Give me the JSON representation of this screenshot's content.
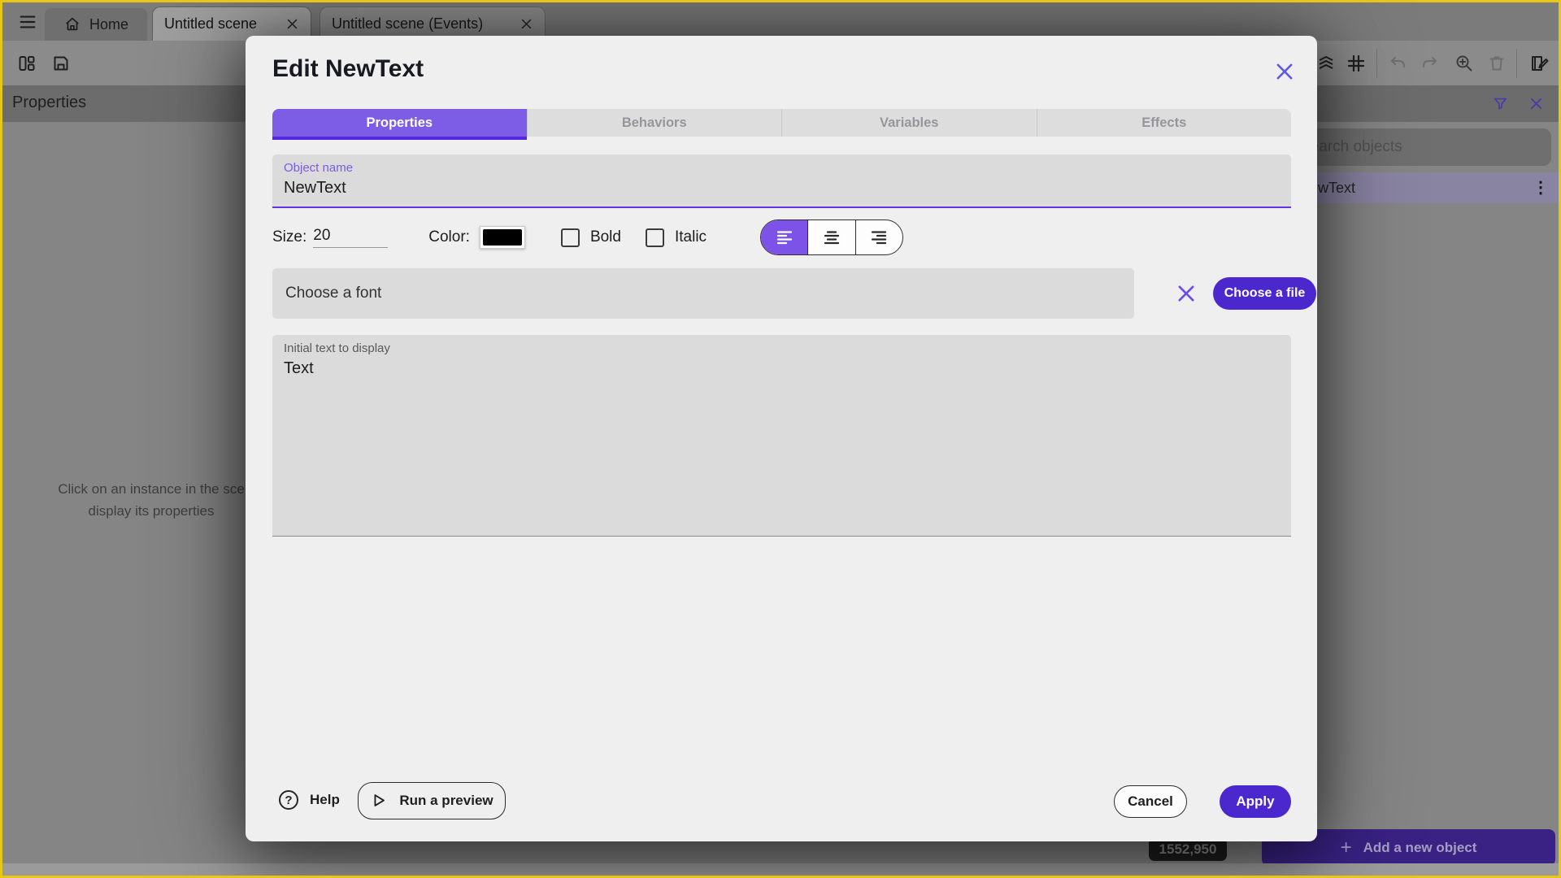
{
  "titlebar": {
    "tabs": [
      {
        "label": "Home",
        "active": false
      },
      {
        "label": "Untitled scene",
        "active": true
      },
      {
        "label": "Untitled scene (Events)",
        "active": false
      }
    ]
  },
  "left_panel": {
    "header": "Properties",
    "empty_message_line1": "Click on an instance in the sce",
    "empty_message_line2": "display its properties"
  },
  "objects_panel": {
    "search_placeholder": "Search objects",
    "items": [
      {
        "name": "NewText",
        "selected": true
      }
    ],
    "add_button_label": "Add a new object"
  },
  "scene": {
    "coordinates": "1552,950"
  },
  "dialog": {
    "title": "Edit NewText",
    "tabs": [
      {
        "label": "Properties",
        "active": true
      },
      {
        "label": "Behaviors",
        "active": false
      },
      {
        "label": "Variables",
        "active": false
      },
      {
        "label": "Effects",
        "active": false
      }
    ],
    "object_name": {
      "label": "Object name",
      "value": "NewText"
    },
    "size": {
      "label": "Size:",
      "value": "20"
    },
    "color": {
      "label": "Color:",
      "value_hex": "#000000"
    },
    "style": {
      "bold_label": "Bold",
      "bold_checked": false,
      "italic_label": "Italic",
      "italic_checked": false
    },
    "alignment": {
      "selected": "left",
      "options": [
        "left",
        "center",
        "right"
      ]
    },
    "font": {
      "placeholder": "Choose a font",
      "button_label": "Choose a file"
    },
    "initial_text": {
      "label": "Initial text to display",
      "value": "Text"
    },
    "footer": {
      "help_label": "Help",
      "run_preview_label": "Run a preview",
      "cancel_label": "Cancel",
      "apply_label": "Apply"
    }
  },
  "icons": {
    "help_glyph": "?",
    "plus_glyph": "+",
    "kebab_glyph": "⋮"
  },
  "colors": {
    "frame": "#E8C615",
    "accent": "#7D5DE6",
    "accent_dark": "#4B28CE",
    "tab_underline": "#5527E0",
    "field_bg": "#DBDBDB",
    "text_color_value": "#000000"
  }
}
